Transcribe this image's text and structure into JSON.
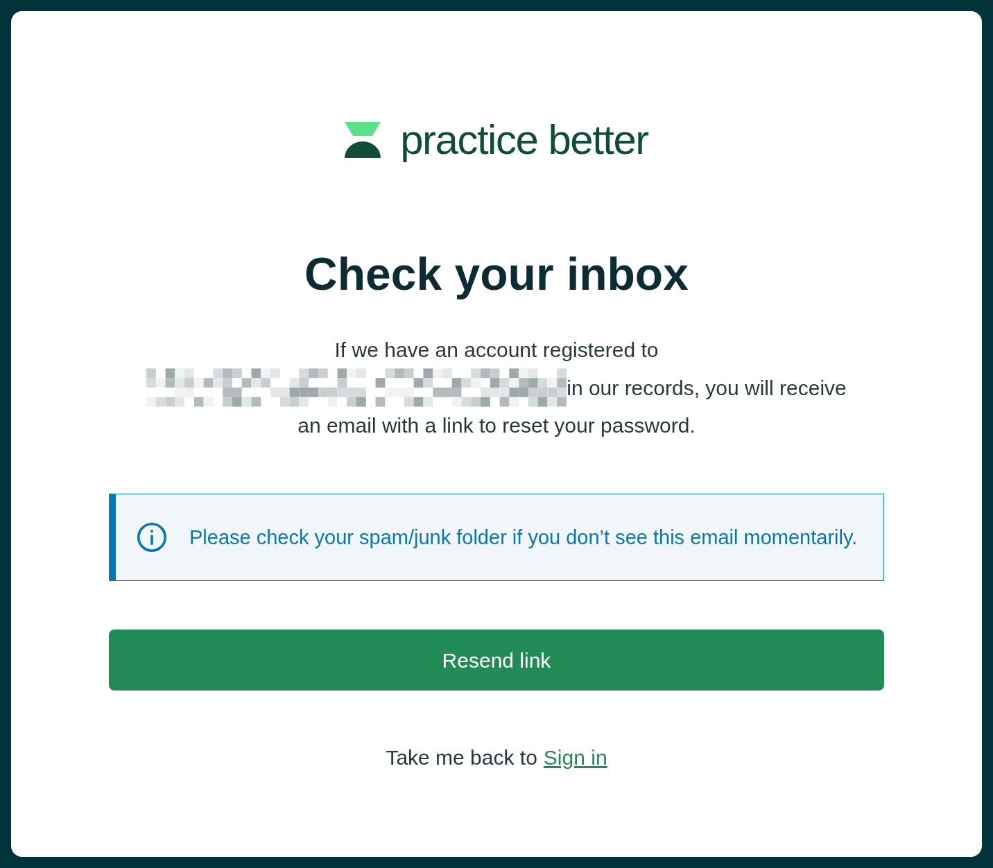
{
  "logo": {
    "text": "practice better"
  },
  "title": "Check your inbox",
  "message_lines": [
    "If we have an account registered to",
    "in our records, you will receive",
    "an email with a link to reset your password."
  ],
  "notice": {
    "text": "Please check your spam/junk folder if you don’t see this email momentarily."
  },
  "button": {
    "label": "Resend link"
  },
  "footer": {
    "text": "Take me back to",
    "link": "Sign in"
  }
}
